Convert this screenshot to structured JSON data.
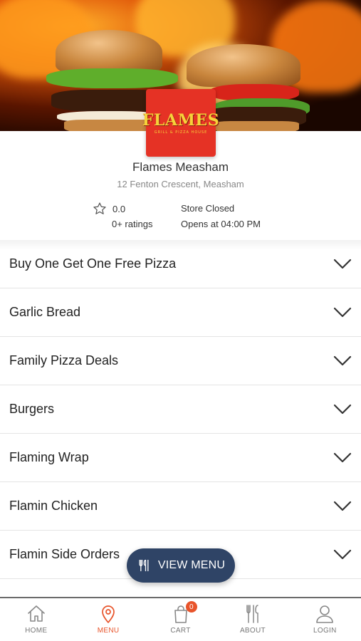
{
  "store": {
    "logo_text": "FLAMES",
    "logo_subtext": "GRILL & PIZZA HOUSE",
    "name": "Flames Measham",
    "address": "12 Fenton Crescent, Measham",
    "rating": "0.0",
    "rating_count": "0+ ratings",
    "status": "Store Closed",
    "opens": "Opens at 04:00 PM"
  },
  "categories": [
    {
      "label": "Buy One Get One Free Pizza"
    },
    {
      "label": "Garlic Bread"
    },
    {
      "label": "Family Pizza Deals"
    },
    {
      "label": "Burgers"
    },
    {
      "label": "Flaming Wrap"
    },
    {
      "label": "Flamin Chicken"
    },
    {
      "label": "Flamin Side Orders"
    }
  ],
  "view_menu": {
    "label": "VIEW MENU",
    "icon": "cutlery-icon"
  },
  "nav": {
    "items": [
      {
        "label": "HOME",
        "icon": "home-icon"
      },
      {
        "label": "MENU",
        "icon": "location-pin-icon",
        "active": true
      },
      {
        "label": "CART",
        "icon": "shopping-bag-icon",
        "badge": "0"
      },
      {
        "label": "ABOUT",
        "icon": "cutlery-icon"
      },
      {
        "label": "LOGIN",
        "icon": "user-icon"
      }
    ]
  },
  "colors": {
    "accent": "#e8542b",
    "pill": "#2f4466",
    "logo_bg": "#e53225",
    "logo_text": "#f6d23a"
  }
}
